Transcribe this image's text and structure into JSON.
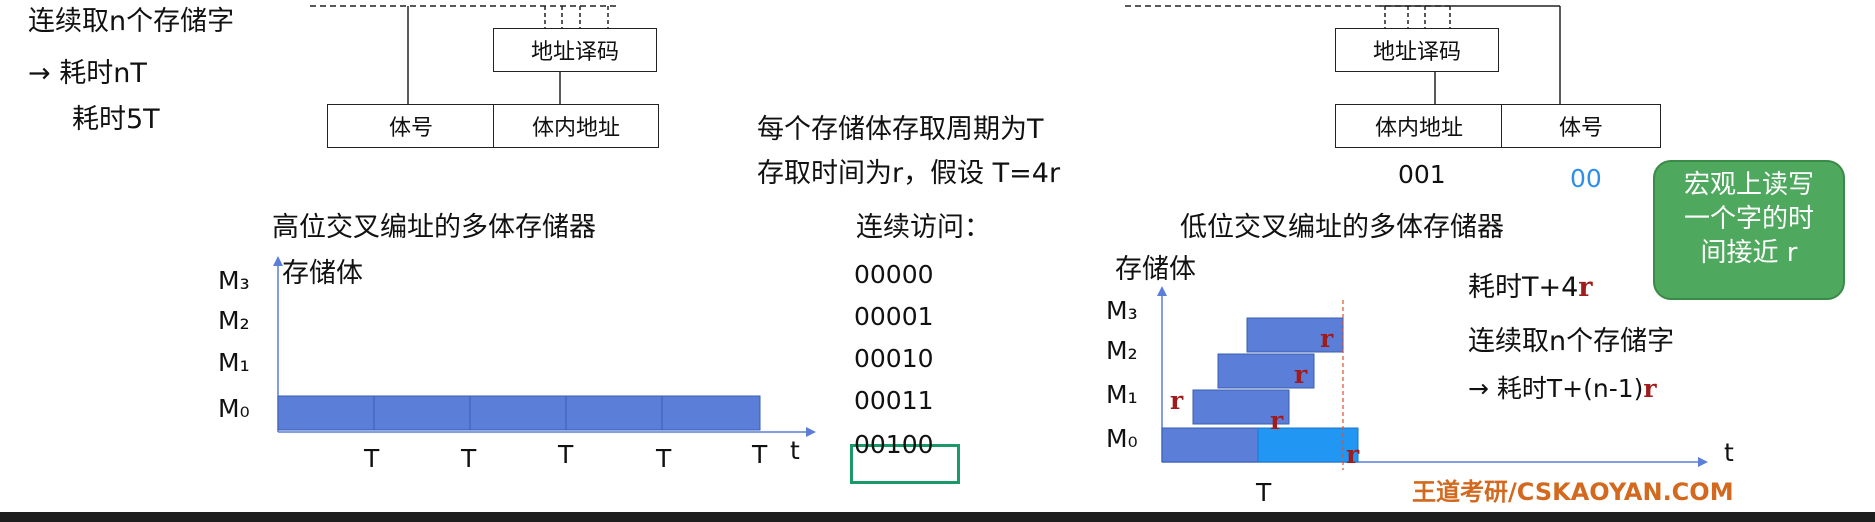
{
  "left_notes": {
    "line1": "连续取n个存储字",
    "line2": "耗时nT",
    "line3": "耗时5T",
    "arrow": "→"
  },
  "left_diagram": {
    "decoder_label": "地址译码",
    "field_bank": "体号",
    "field_offset": "体内地址",
    "title": "高位交叉编址的多体存储器",
    "ylabel": "存储体",
    "m_labels": [
      "M₃",
      "M₂",
      "M₁",
      "M₀"
    ],
    "t_label": "T",
    "axis_label": "t"
  },
  "middle": {
    "line1": "每个存储体存取周期为T",
    "line2": "存取时间为r，假设 T=4r",
    "access_title": "连续访问：",
    "addresses": [
      "00000",
      "00001",
      "00010",
      "00011",
      "00100"
    ]
  },
  "right_diagram": {
    "decoder_label": "地址译码",
    "field_offset": "体内地址",
    "field_bank": "体号",
    "addr_offset": "001",
    "addr_bank": "00",
    "title": "低位交叉编址的多体存储器",
    "ylabel": "存储体",
    "m_labels": [
      "M₃",
      "M₂",
      "M₁",
      "M₀"
    ],
    "r_label": "r",
    "t_label": "T",
    "axis_label": "t",
    "time_prefix": "耗时T+4",
    "time_r": "r",
    "continuous": "连续取n个存储字",
    "formula_prefix": "→ 耗时T+(n-1)",
    "formula_r": "r"
  },
  "tooltip": {
    "line1": "宏观上读写",
    "line2": "一个字的时",
    "line3": "间接近 r"
  },
  "watermark": "王道考研/CSKAOYAN.COM",
  "colors": {
    "block_blue": "#5b7fd8",
    "block_cyan": "#2196f3",
    "highlight_green": "#1a9a6a",
    "tooltip_green": "#4ea85d",
    "r_red": "#a01b1b",
    "watermark_orange": "#d2691e"
  }
}
